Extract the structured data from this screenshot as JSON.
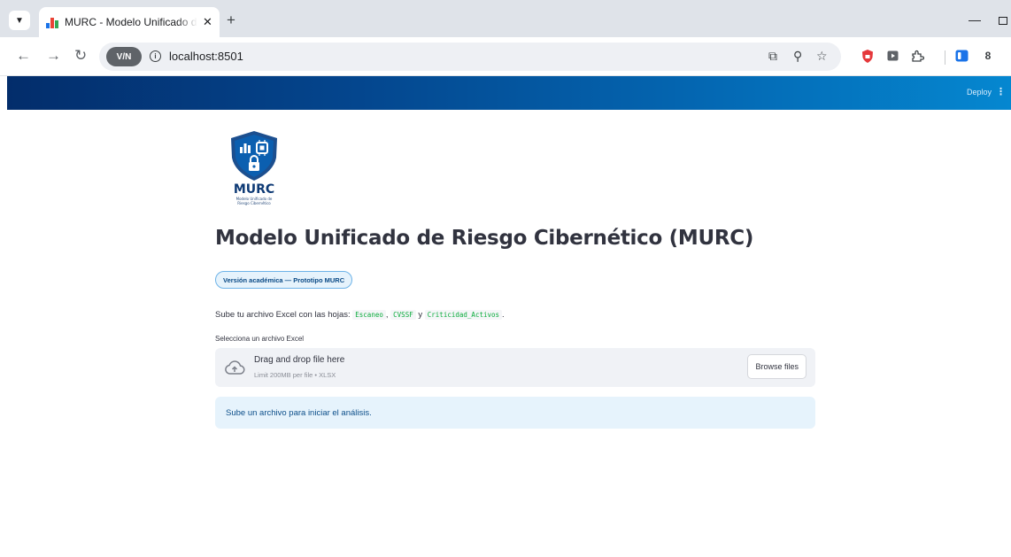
{
  "browser": {
    "tab_title": "MURC - Modelo Unificado de Riesgo Cibernético",
    "tab_close": "✕",
    "new_tab": "+",
    "url": "localhost:8501",
    "vpn_label": "V/N"
  },
  "header": {
    "deploy_label": "Deploy",
    "menu_icon": "⋮"
  },
  "logo": {
    "icon": "shield-lock-chip-logo",
    "wordmark": "MURC",
    "tagline_line1": "Modelo Unificado de",
    "tagline_line2": "Riesgo Cibernético"
  },
  "page": {
    "title": "Modelo Unificado de Riesgo Cibernético (MURC)",
    "badge": "Versión académica — Prototipo MURC",
    "instructions": {
      "prefix": "Sube tu archivo Excel con las hojas:",
      "sheet1": "Escaneo",
      "sep1": ",",
      "sheet2": "CVSSF",
      "sep2": "y",
      "sheet3": "Criticidad_Activos",
      "suffix": "."
    }
  },
  "uploader": {
    "label": "Selecciona un archivo Excel",
    "drop_text": "Drag and drop file here",
    "limit_text": "Limit 200MB per file • XLSX",
    "browse_label": "Browse files"
  },
  "info_message": "Sube un archivo para iniciar el análisis.",
  "colors": {
    "header_start": "#032d6b",
    "header_end": "#0587d0",
    "shield_blue": "#0b5fb0",
    "info_bg": "#e6f3fc",
    "code_green": "#09ab3b"
  }
}
